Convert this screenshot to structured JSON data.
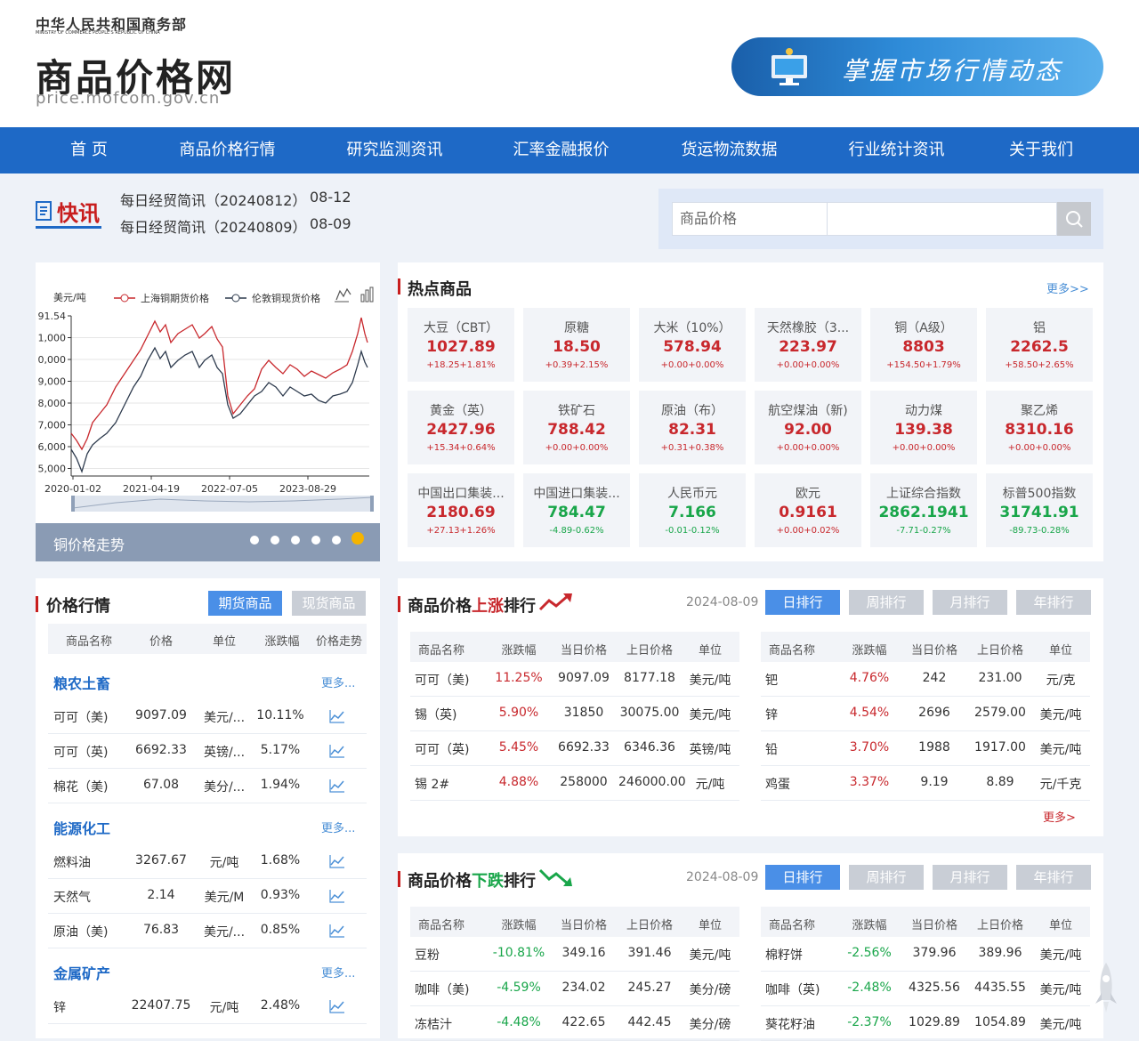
{
  "header": {
    "ministry": "中华人民共和国商务部",
    "ministry_en": "MINISTRY OF COMMERCE PEOPLE'S REPUBLIC OF CHINA",
    "site_title": "商品价格网",
    "site_url": "price.mofcom.gov.cn",
    "banner_text": "掌握市场行情动态"
  },
  "nav": [
    "首 页",
    "商品价格行情",
    "研究监测资讯",
    "汇率金融报价",
    "货运物流数据",
    "行业统计资讯",
    "关于我们"
  ],
  "flash": {
    "label": "快讯",
    "items": [
      {
        "title": "每日经贸简讯（20240812）",
        "date": "08-12"
      },
      {
        "title": "每日经贸简讯（20240809）",
        "date": "08-09"
      }
    ]
  },
  "search": {
    "category": "商品价格",
    "placeholder": ""
  },
  "chart_panel": {
    "footer": "铜价格走势"
  },
  "chart_data": {
    "type": "line",
    "ylabel": "美元/吨",
    "series": [
      {
        "name": "上海铜期货价格"
      },
      {
        "name": "伦敦铜现货价格"
      }
    ],
    "x_ticks": [
      "2020-01-02",
      "2021-04-19",
      "2022-07-05",
      "2023-08-29"
    ],
    "y_ticks": [
      "91.54",
      "1,000",
      "0,000",
      "9,000",
      "8,000",
      "7,000",
      "6,000",
      "5,000"
    ]
  },
  "hot": {
    "title": "热点商品",
    "more": "更多>>",
    "items": [
      {
        "name": "大豆（CBT）",
        "price": "1027.89",
        "change": "+18.25+1.81%",
        "dir": "up"
      },
      {
        "name": "原糖",
        "price": "18.50",
        "change": "+0.39+2.15%",
        "dir": "up"
      },
      {
        "name": "大米（10%）",
        "price": "578.94",
        "change": "+0.00+0.00%",
        "dir": "up"
      },
      {
        "name": "天然橡胶（3...",
        "price": "223.97",
        "change": "+0.00+0.00%",
        "dir": "up"
      },
      {
        "name": "铜（A级）",
        "price": "8803",
        "change": "+154.50+1.79%",
        "dir": "up"
      },
      {
        "name": "铝",
        "price": "2262.5",
        "change": "+58.50+2.65%",
        "dir": "up"
      },
      {
        "name": "黄金（英）",
        "price": "2427.96",
        "change": "+15.34+0.64%",
        "dir": "up"
      },
      {
        "name": "铁矿石",
        "price": "788.42",
        "change": "+0.00+0.00%",
        "dir": "up"
      },
      {
        "name": "原油（布）",
        "price": "82.31",
        "change": "+0.31+0.38%",
        "dir": "up"
      },
      {
        "name": "航空煤油（新)",
        "price": "92.00",
        "change": "+0.00+0.00%",
        "dir": "up"
      },
      {
        "name": "动力煤",
        "price": "139.38",
        "change": "+0.00+0.00%",
        "dir": "up"
      },
      {
        "name": "聚乙烯",
        "price": "8310.16",
        "change": "+0.00+0.00%",
        "dir": "up"
      },
      {
        "name": "中国出口集装...",
        "price": "2180.69",
        "change": "+27.13+1.26%",
        "dir": "up"
      },
      {
        "name": "中国进口集装...",
        "price": "784.47",
        "change": "-4.89-0.62%",
        "dir": "down"
      },
      {
        "name": "人民币元",
        "price": "7.166",
        "change": "-0.01-0.12%",
        "dir": "down"
      },
      {
        "name": "欧元",
        "price": "0.9161",
        "change": "+0.00+0.02%",
        "dir": "up"
      },
      {
        "name": "上证综合指数",
        "price": "2862.1941",
        "change": "-7.71-0.27%",
        "dir": "down"
      },
      {
        "name": "标普500指数",
        "price": "31741.91",
        "change": "-89.73-0.28%",
        "dir": "down"
      }
    ]
  },
  "price": {
    "title": "价格行情",
    "tabs": [
      "期货商品",
      "现货商品"
    ],
    "headers": [
      "商品名称",
      "价格",
      "单位",
      "涨跌幅",
      "价格走势"
    ],
    "more": "更多...",
    "groups": [
      {
        "name": "粮农土畜",
        "rows": [
          {
            "name": "可可（美)",
            "price": "9097.09",
            "unit": "美元/...",
            "chg": "10.11%"
          },
          {
            "name": "可可（英)",
            "price": "6692.33",
            "unit": "英镑/...",
            "chg": "5.17%"
          },
          {
            "name": "棉花（美)",
            "price": "67.08",
            "unit": "美分/...",
            "chg": "1.94%"
          }
        ]
      },
      {
        "name": "能源化工",
        "rows": [
          {
            "name": "燃料油",
            "price": "3267.67",
            "unit": "元/吨",
            "chg": "1.68%"
          },
          {
            "name": "天然气",
            "price": "2.14",
            "unit": "美元/M",
            "chg": "0.93%"
          },
          {
            "name": "原油（美)",
            "price": "76.83",
            "unit": "美元/...",
            "chg": "0.85%"
          }
        ]
      },
      {
        "name": "金属矿产",
        "rows": [
          {
            "name": "锌",
            "price": "22407.75",
            "unit": "元/吨",
            "chg": "2.48%"
          }
        ]
      }
    ]
  },
  "rank_up": {
    "title_pre": "商品价格",
    "title_hl": "上涨",
    "title_post": "排行",
    "date": "2024-08-09",
    "tabs": [
      "日排行",
      "周排行",
      "月排行",
      "年排行"
    ],
    "headers": [
      "商品名称",
      "涨跌幅",
      "当日价格",
      "上日价格",
      "单位"
    ],
    "more": "更多>",
    "left": [
      [
        "可可（美)",
        "11.25%",
        "9097.09",
        "8177.18",
        "美元/吨"
      ],
      [
        "锡（英)",
        "5.90%",
        "31850",
        "30075.00",
        "美元/吨"
      ],
      [
        "可可（英)",
        "5.45%",
        "6692.33",
        "6346.36",
        "英镑/吨"
      ],
      [
        "锡 2#",
        "4.88%",
        "258000",
        "246000.00",
        "元/吨"
      ]
    ],
    "right": [
      [
        "钯",
        "4.76%",
        "242",
        "231.00",
        "元/克"
      ],
      [
        "锌",
        "4.54%",
        "2696",
        "2579.00",
        "美元/吨"
      ],
      [
        "铅",
        "3.70%",
        "1988",
        "1917.00",
        "美元/吨"
      ],
      [
        "鸡蛋",
        "3.37%",
        "9.19",
        "8.89",
        "元/千克"
      ]
    ]
  },
  "rank_down": {
    "title_pre": "商品价格",
    "title_hl": "下跌",
    "title_post": "排行",
    "date": "2024-08-09",
    "tabs": [
      "日排行",
      "周排行",
      "月排行",
      "年排行"
    ],
    "headers": [
      "商品名称",
      "涨跌幅",
      "当日价格",
      "上日价格",
      "单位"
    ],
    "left": [
      [
        "豆粉",
        "-10.81%",
        "349.16",
        "391.46",
        "美元/吨"
      ],
      [
        "咖啡（美)",
        "-4.59%",
        "234.02",
        "245.27",
        "美分/磅"
      ],
      [
        "冻桔汁",
        "-4.48%",
        "422.65",
        "442.45",
        "美分/磅"
      ]
    ],
    "right": [
      [
        "棉籽饼",
        "-2.56%",
        "379.96",
        "389.96",
        "美元/吨"
      ],
      [
        "咖啡（英)",
        "-2.48%",
        "4325.56",
        "4435.55",
        "美元/吨"
      ],
      [
        "葵花籽油",
        "-2.37%",
        "1029.89",
        "1054.89",
        "美元/吨"
      ]
    ]
  },
  "colors": {
    "nav": "#1e69c6",
    "up": "#c8282d",
    "down": "#19a64a",
    "tab_active": "#4a8fe7"
  }
}
